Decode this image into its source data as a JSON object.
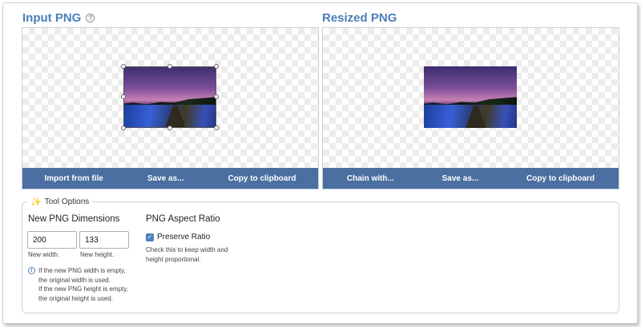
{
  "input_panel": {
    "title": "Input PNG",
    "buttons": [
      "Import from file",
      "Save as...",
      "Copy to clipboard"
    ]
  },
  "output_panel": {
    "title": "Resized PNG",
    "buttons": [
      "Chain with...",
      "Save as...",
      "Copy to clipboard"
    ]
  },
  "tool_options": {
    "legend": "Tool Options",
    "dimensions": {
      "title": "New PNG Dimensions",
      "width_value": "200",
      "height_value": "133",
      "width_hint": "New width.",
      "height_hint": "New height.",
      "info_lines": [
        "If the new PNG width is empty,",
        "the original width is used.",
        "If the new PNG height is empty,",
        "the original height is used."
      ]
    },
    "aspect": {
      "title": "PNG Aspect Ratio",
      "checkbox_label": "Preserve Ratio",
      "checked": true,
      "description": "Check this to keep width and height proportional."
    }
  },
  "colors": {
    "accent": "#4a7fb8",
    "button_bar": "#4a6fa0"
  }
}
